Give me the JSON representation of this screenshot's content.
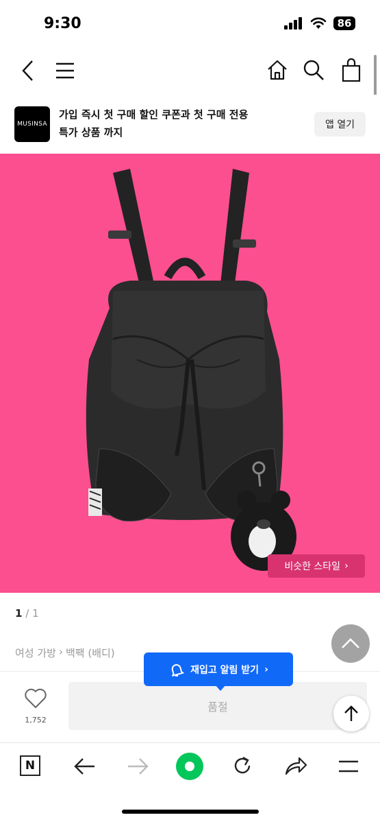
{
  "status": {
    "time": "9:30",
    "battery": "86"
  },
  "nav": {
    "back_icon": "chevron-left-icon",
    "menu_icon": "hamburger-icon",
    "home_icon": "home-icon",
    "search_icon": "search-icon",
    "cart_icon": "shopping-bag-icon"
  },
  "banner": {
    "logo": "MUSINSA",
    "text_line1": "가입 즉시 첫 구매 할인 쿠폰과 첫 구매 전용",
    "text_line2": "특가 상품 까지",
    "open_app": "앱 열기"
  },
  "hero": {
    "background": "#fb4f8f",
    "similar_style": "비슷한 스타일",
    "similar_chevron": "›"
  },
  "gallery": {
    "current": "1",
    "separator": "/",
    "total": "1"
  },
  "breadcrumb": {
    "category": "여성 가방",
    "sep": "›",
    "subcategory": "백팩 (배디)"
  },
  "restock_tooltip": {
    "label": "재입고 알림 받기",
    "chevron": "›",
    "color": "#1169f7"
  },
  "purchase": {
    "like_count": "1,752",
    "soldout_label": "품절"
  },
  "browser": {
    "n_label": "N",
    "accent": "#03c75a"
  }
}
